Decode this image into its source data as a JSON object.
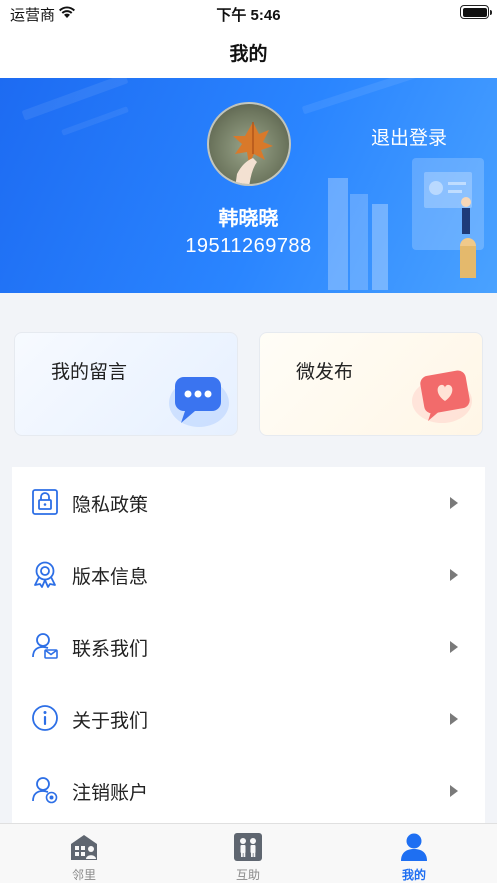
{
  "status_bar": {
    "carrier": "运营商",
    "time": "下午 5:46"
  },
  "nav": {
    "title": "我的"
  },
  "profile": {
    "name": "韩晓晓",
    "phone": "19511269788",
    "logout_label": "退出登录"
  },
  "cards": [
    {
      "label": "我的留言",
      "icon": "chat-bubble-icon"
    },
    {
      "label": "微发布",
      "icon": "heart-bubble-icon"
    }
  ],
  "menu": [
    {
      "label": "隐私政策",
      "icon": "lock-icon"
    },
    {
      "label": "版本信息",
      "icon": "badge-icon"
    },
    {
      "label": "联系我们",
      "icon": "contact-mail-icon"
    },
    {
      "label": "关于我们",
      "icon": "info-icon"
    },
    {
      "label": "注销账户",
      "icon": "user-cancel-icon"
    }
  ],
  "tabs": [
    {
      "label": "邻里",
      "icon": "neighborhood-icon",
      "active": false
    },
    {
      "label": "互助",
      "icon": "mutual-help-icon",
      "active": false
    },
    {
      "label": "我的",
      "icon": "person-icon",
      "active": true
    }
  ],
  "colors": {
    "accent": "#1e6ff2",
    "header_start": "#1d6bf2",
    "header_end": "#4aa2ff"
  }
}
